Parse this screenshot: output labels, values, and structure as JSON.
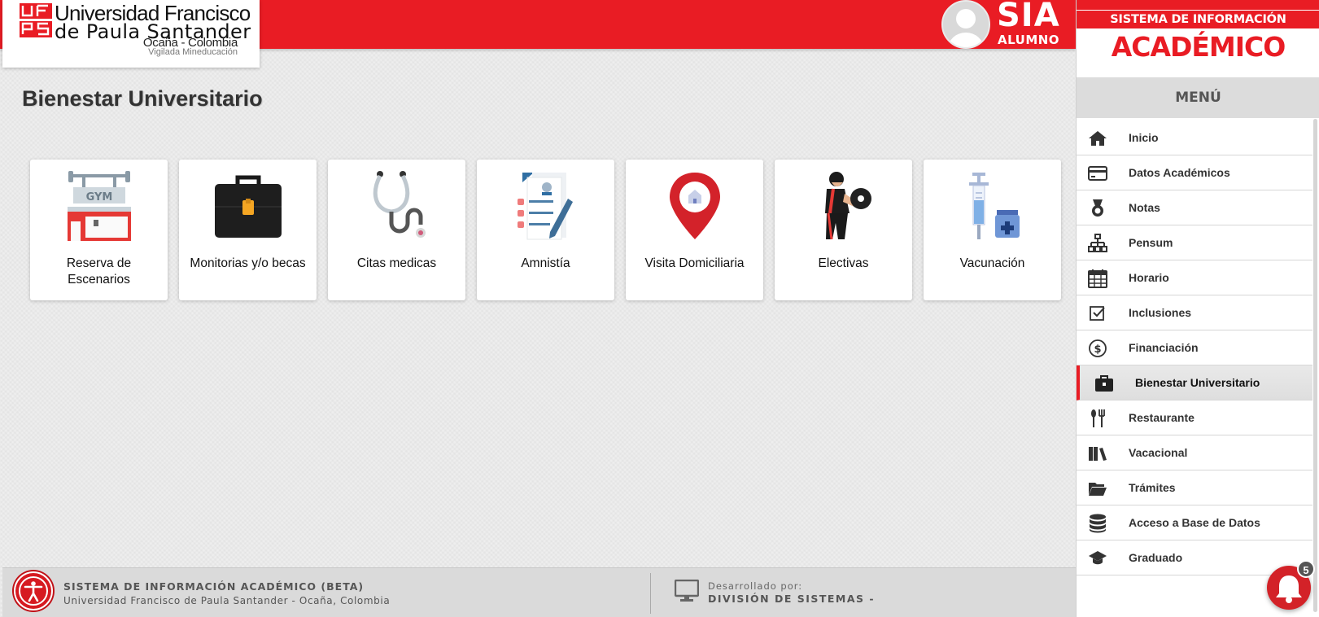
{
  "header": {
    "logo_mark": "UFPS",
    "university_line1": "Universidad Francisco",
    "university_line2": "de Paula Santander",
    "location": "Ocaña - Colombia",
    "tagline": "Vigilada Mineducación",
    "app_name": "SIA",
    "app_sub": "ALUMNO",
    "brand_color": "#e91c24"
  },
  "page": {
    "title": "Bienestar Universitario"
  },
  "cards": [
    {
      "label": "Reserva de Escenarios",
      "icon": "gym-icon"
    },
    {
      "label": "Monitorias y/o becas",
      "icon": "briefcase-icon"
    },
    {
      "label": "Citas medicas",
      "icon": "stethoscope-icon"
    },
    {
      "label": "Amnistía",
      "icon": "document-pen-icon"
    },
    {
      "label": "Visita Domiciliaria",
      "icon": "location-pin-icon"
    },
    {
      "label": "Electivas",
      "icon": "weightlifter-icon"
    },
    {
      "label": "Vacunación",
      "icon": "syringe-icon"
    }
  ],
  "sidebar": {
    "system_label": "SISTEMA DE INFORMACIÓN",
    "academic_label": "ACADÉMICO",
    "menu_label": "MENÚ",
    "items": [
      {
        "label": "Inicio",
        "icon": "home-icon"
      },
      {
        "label": "Datos Académicos",
        "icon": "credit-card-icon"
      },
      {
        "label": "Notas",
        "icon": "medal-icon"
      },
      {
        "label": "Pensum",
        "icon": "sitemap-icon"
      },
      {
        "label": "Horario",
        "icon": "calendar-icon"
      },
      {
        "label": "Inclusiones",
        "icon": "checkbox-icon"
      },
      {
        "label": "Financiación",
        "icon": "dollar-circle-icon"
      },
      {
        "label": "Bienestar Universitario",
        "icon": "toolbox-icon",
        "active": true
      },
      {
        "label": "Restaurante",
        "icon": "utensils-icon"
      },
      {
        "label": "Vacacional",
        "icon": "books-icon"
      },
      {
        "label": "Trámites",
        "icon": "folder-open-icon"
      },
      {
        "label": "Acceso a Base de Datos",
        "icon": "database-icon"
      },
      {
        "label": "Graduado",
        "icon": "graduation-cap-icon"
      }
    ]
  },
  "footer": {
    "title": "SISTEMA DE INFORMACIÓN ACADÉMICO (BETA)",
    "subtitle": "Universidad Francisco de Paula Santander - Ocaña, Colombia",
    "developed_by": "Desarrollado por:",
    "division": "DIVISIÓN DE SISTEMAS -"
  },
  "notifications": {
    "count": "5"
  }
}
